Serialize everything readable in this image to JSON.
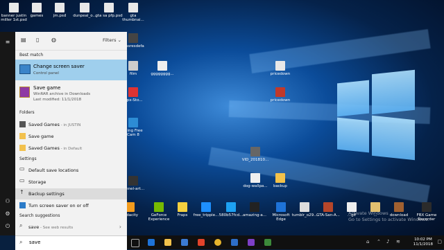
{
  "desktop_icons": [
    {
      "label": "banner justin miller 1st.psd",
      "color": "#e8e8e8"
    },
    {
      "label": "games",
      "color": "#e8e8e8"
    },
    {
      "label": "jm.psd",
      "color": "#e8e8e8"
    },
    {
      "label": "dunpeal_o...",
      "color": "#e8e8e8"
    },
    {
      "label": "gta sa pfp.psd",
      "color": "#e8e8e8"
    },
    {
      "label": "gta thumbnai...",
      "color": "#e8e8e8"
    },
    {
      "label": "pricedown",
      "color": "#e8e8e8"
    },
    {
      "label": "pricedown",
      "color": "#c0392b"
    },
    {
      "label": "VID_201810...",
      "color": "#666666"
    },
    {
      "label": "dog-wallpa...",
      "color": "#f0f0f0"
    },
    {
      "label": "backup",
      "color": "#f3c24b"
    },
    {
      "label": "film",
      "color": "#cccccc"
    },
    {
      "label": "gggggggg...",
      "color": "#eeeeee"
    },
    {
      "label": "Opx-Sto...",
      "color": "#d33"
    },
    {
      "label": "...ing Free Cam 8",
      "color": "#2d8cd4"
    },
    {
      "label": "...ssresdefa",
      "color": "#444"
    },
    {
      "label": "...nnel-art...",
      "color": "#333"
    }
  ],
  "desktop_bottom_icons": [
    {
      "label": "Audacity",
      "color": "#f29b1d"
    },
    {
      "label": "GeForce Experience",
      "color": "#76b900"
    },
    {
      "label": "Fraps",
      "color": "#f4d03f"
    },
    {
      "label": "free_trippie...",
      "color": "#1e90ff"
    },
    {
      "label": "580b57fcd...",
      "color": "#1da1f2"
    },
    {
      "label": "amazing-a...",
      "color": "#222"
    },
    {
      "label": "Microsoft Edge",
      "color": "#1e73d8"
    },
    {
      "label": "tumblr_o29...",
      "color": "#ddd"
    },
    {
      "label": "GTA-San-A...",
      "color": "#b5462a"
    },
    {
      "label": "...gif",
      "color": "#eee"
    },
    {
      "label": "...",
      "color": "#e2c070"
    },
    {
      "label": "download",
      "color": "#a06030"
    },
    {
      "label": "FBX Game Recorder",
      "color": "#2b2b2b"
    }
  ],
  "start_rail": {
    "menu_icon": "≡",
    "user_icon": "⚇",
    "gear_icon": "⚙",
    "power_icon": "⏻"
  },
  "search_panel": {
    "filters_label": "Filters",
    "sections": {
      "best_match": "Best match",
      "folders": "Folders",
      "settings": "Settings",
      "search_suggestions": "Search suggestions"
    },
    "best_match": {
      "title": "Change screen saver",
      "subtitle": "Control panel"
    },
    "save_game": {
      "title": "Save game",
      "line1": "WinRAR archive in Downloads",
      "line2": "Last modified: 11/1/2018"
    },
    "folders": [
      {
        "label": "Saved Games",
        "suffix": " - in JUSTIN"
      },
      {
        "label": "Save game",
        "suffix": ""
      },
      {
        "label": "Saved Games",
        "suffix": " - in Default"
      }
    ],
    "settings": [
      {
        "label": "Default save locations"
      },
      {
        "label": "Storage"
      },
      {
        "label": "Backup settings"
      },
      {
        "label": "Turn screen saver on or off"
      }
    ],
    "suggestion": {
      "label": "save",
      "suffix": " - See web results"
    },
    "search_value": "save"
  },
  "watermark": {
    "line1": "Activate Windows",
    "line2": "Go to Settings to activate Windows."
  },
  "clock": {
    "time": "10:02 PM",
    "date": "11/1/2018"
  },
  "accent": "#0078d7"
}
